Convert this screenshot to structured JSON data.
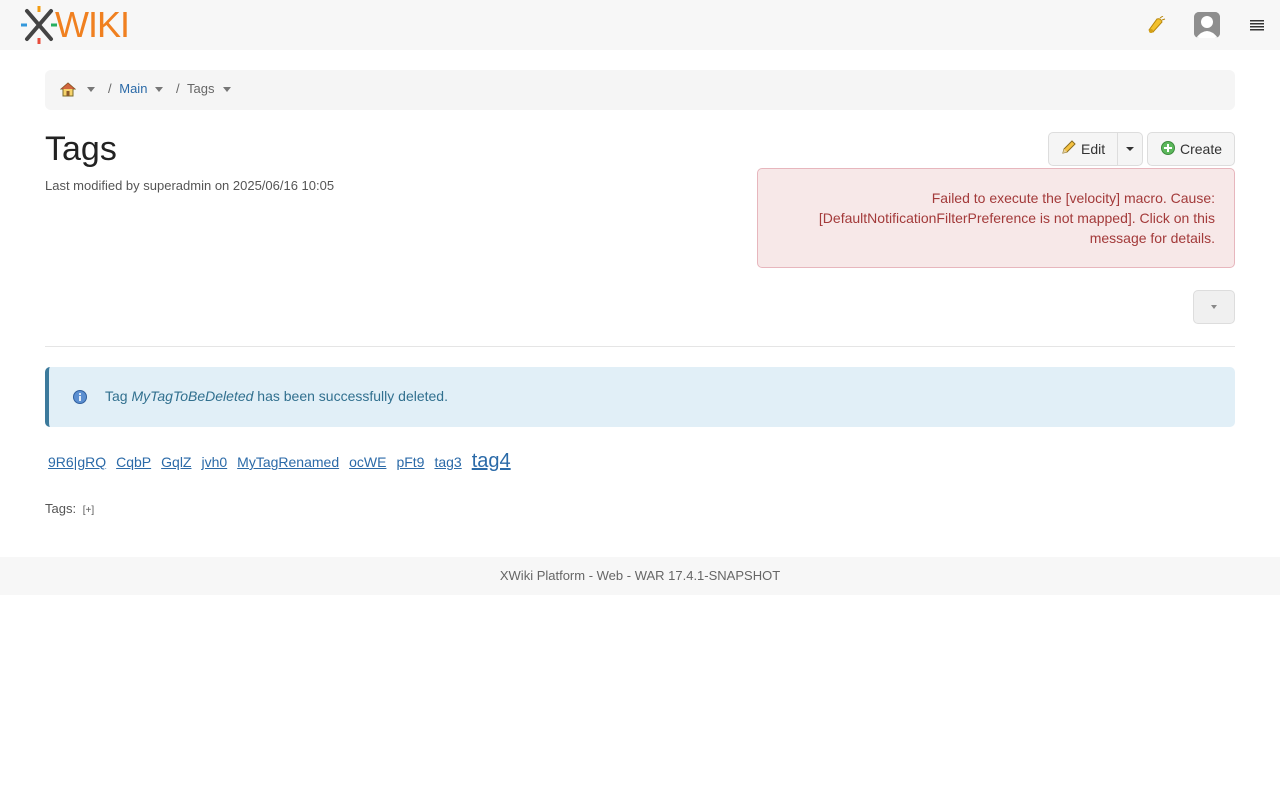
{
  "header": {
    "logo_text": "WIKI",
    "icons": [
      "notifications-icon",
      "user-avatar-icon",
      "menu-icon"
    ]
  },
  "breadcrumb": {
    "items": [
      {
        "label": "Main"
      },
      {
        "label": "Tags"
      }
    ],
    "separator": "/"
  },
  "page": {
    "title": "Tags",
    "last_modified": "Last modified by superadmin on 2025/06/16 10:05"
  },
  "actions": {
    "edit_label": "Edit",
    "create_label": "Create"
  },
  "error": {
    "message": "Failed to execute the [velocity] macro. Cause: [DefaultNotificationFilterPreference is not mapped]. Click on this message for details."
  },
  "info": {
    "prefix": "Tag",
    "tag": "MyTagToBeDeleted",
    "suffix": "has been successfully deleted."
  },
  "tag_cloud": [
    {
      "label": "9R6|gRQ",
      "big": false
    },
    {
      "label": "CqbP",
      "big": false
    },
    {
      "label": "GqlZ",
      "big": false
    },
    {
      "label": "jvh0",
      "big": false
    },
    {
      "label": "MyTagRenamed",
      "big": false
    },
    {
      "label": "ocWE",
      "big": false
    },
    {
      "label": "pFt9",
      "big": false
    },
    {
      "label": "tag3",
      "big": false
    },
    {
      "label": "tag4",
      "big": true
    }
  ],
  "tags_section": {
    "label": "Tags:",
    "add_label": "[+]"
  },
  "footer": {
    "text": "XWiki Platform - Web - WAR 17.4.1-SNAPSHOT"
  },
  "colors": {
    "link": "#2b6aa8",
    "error_text": "#a33a3a",
    "error_bg": "#f7e8e8",
    "info_bg": "#e1eff7",
    "info_text": "#31708f",
    "logo_orange": "#f08020"
  }
}
